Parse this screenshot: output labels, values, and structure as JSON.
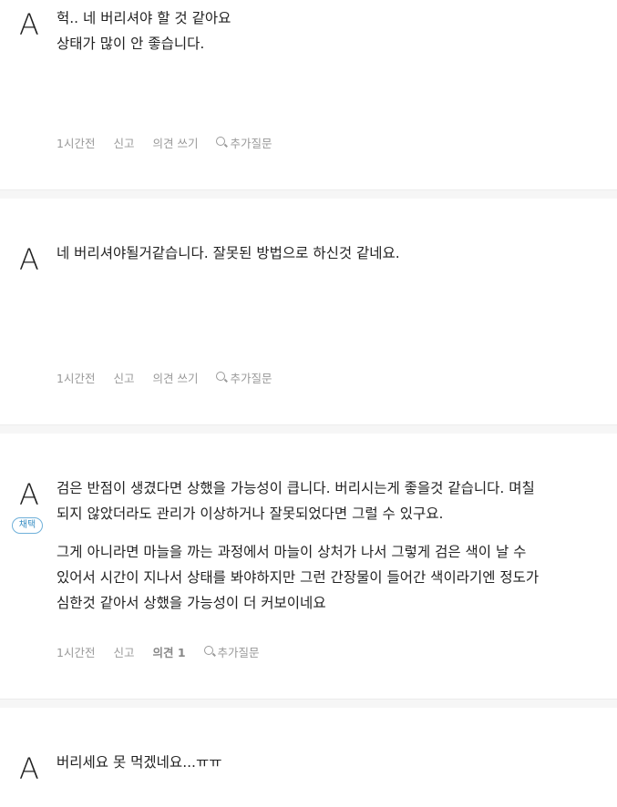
{
  "answers": [
    {
      "avatar": "A",
      "lines": [
        "헉.. 네 버리셔야 할 것 같아요",
        "상태가 많이 안 좋습니다."
      ],
      "meta": {
        "time": "1시간전",
        "report": "신고",
        "opinion": "의견 쓰기",
        "followup": "추가질문"
      }
    },
    {
      "avatar": "A",
      "lines": [
        "네 버리셔야될거같습니다. 잘못된 방법으로 하신것 같네요."
      ],
      "meta": {
        "time": "1시간전",
        "report": "신고",
        "opinion": "의견 쓰기",
        "followup": "추가질문"
      }
    },
    {
      "avatar": "A",
      "badge": "채택",
      "lines": [
        "검은 반점이 생겼다면 상했을 가능성이 큽니다. 버리시는게 좋을것 같습니다. 며칠",
        "되지 않았더라도 관리가 이상하거나 잘못되었다면 그럴 수 있구요.",
        "그게 아니라면 마늘을 까는 과정에서 마늘이 상처가 나서 그렇게 검은 색이 날 수",
        "있어서 시간이 지나서 상태를 봐야하지만 그런 간장물이 들어간 색이라기엔 정도가",
        "심한것 같아서 상했을 가능성이 더 커보이네요"
      ],
      "meta": {
        "time": "1시간전",
        "report": "신고",
        "opinion": "의견 1",
        "followup": "추가질문"
      }
    },
    {
      "avatar": "A",
      "lines": [
        "버리세요 못 먹겠네요...ㅠㅠ"
      ]
    }
  ]
}
